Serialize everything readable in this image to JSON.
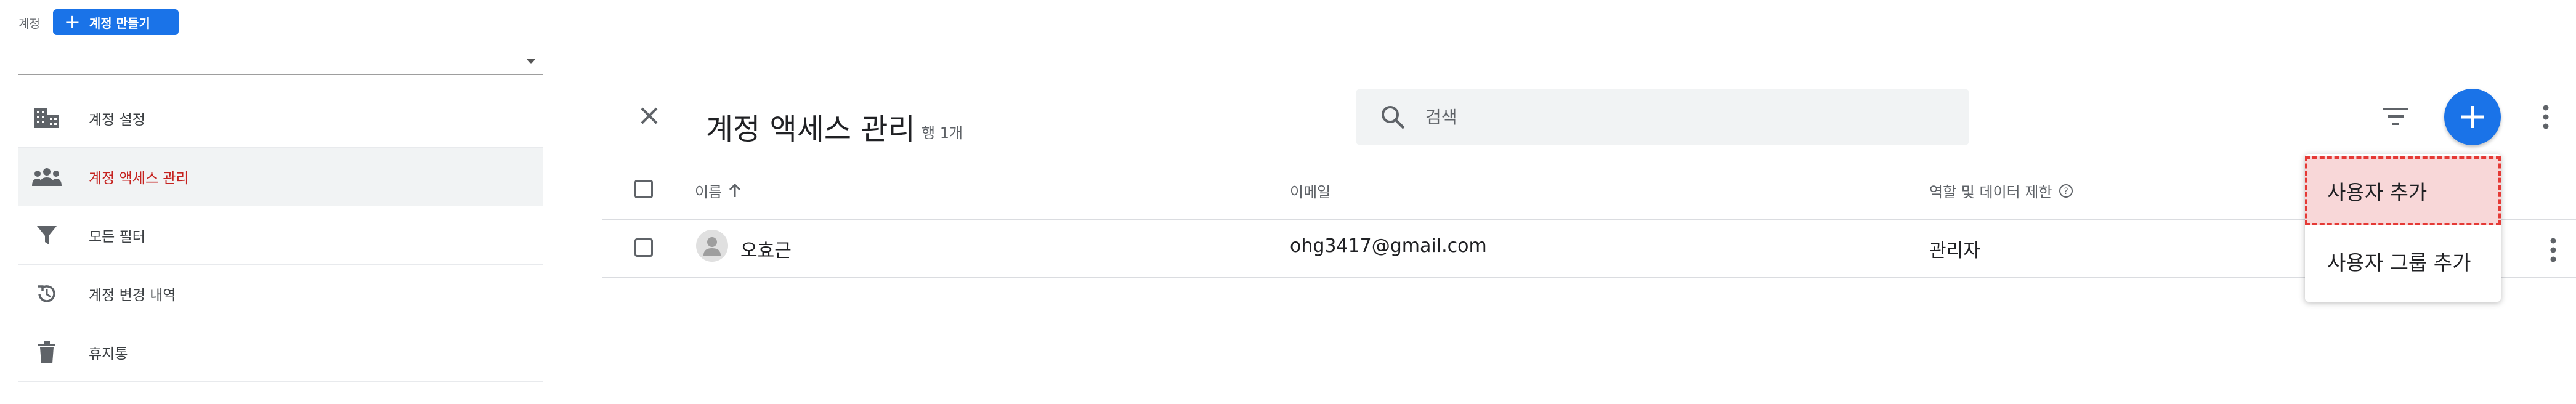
{
  "account": {
    "label": "계정",
    "create_button": "계정 만들기",
    "selected": ""
  },
  "nav": {
    "items": [
      {
        "label": "계정 설정",
        "icon": "building-icon"
      },
      {
        "label": "계정 액세스 관리",
        "icon": "people-icon",
        "active": true
      },
      {
        "label": "모든 필터",
        "icon": "filter-icon"
      },
      {
        "label": "계정 변경 내역",
        "icon": "history-icon"
      },
      {
        "label": "휴지통",
        "icon": "trash-icon"
      }
    ]
  },
  "header": {
    "title": "계정 액세스 관리",
    "row_count": "행 1개",
    "search_placeholder": "검색"
  },
  "table": {
    "columns": [
      "이름",
      "이메일",
      "역할 및 데이터 제한"
    ],
    "rows": [
      {
        "name": "오효근",
        "email": "ohg3417@gmail.com",
        "role": "관리자"
      }
    ]
  },
  "menu": {
    "items": [
      "사용자 추가",
      "사용자 그룹 추가"
    ]
  },
  "colors": {
    "accent": "#1a73e8",
    "active_nav_text": "#c5221f",
    "highlight_border": "#e53935",
    "highlight_fill": "#f8d7d8"
  }
}
